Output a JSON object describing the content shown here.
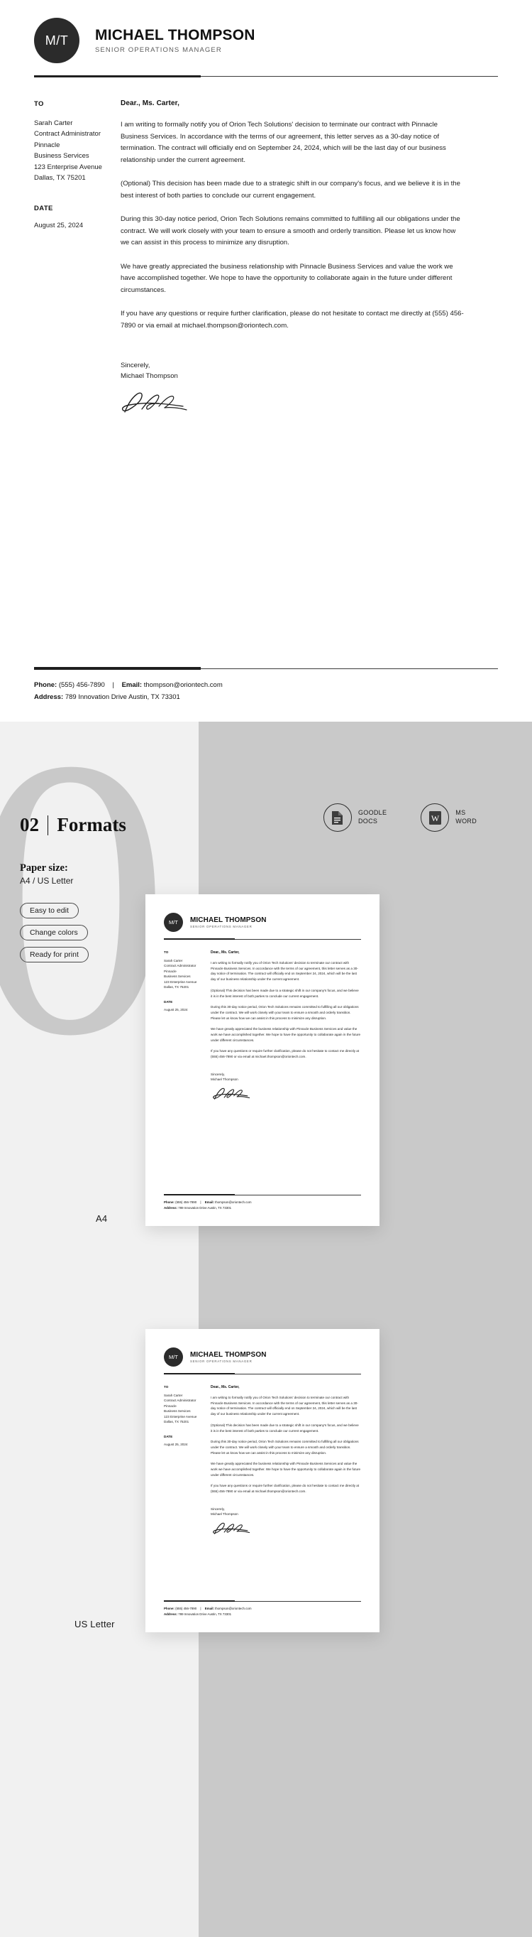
{
  "letterhead": {
    "monogram": "M/T",
    "name": "MICHAEL THOMPSON",
    "role": "SENIOR OPERATIONS MANAGER"
  },
  "meta": {
    "to_label": "TO",
    "recipient": [
      "Sarah Carter",
      "Contract Administrator",
      "Pinnacle",
      "Business Services",
      "123 Enterprise Avenue",
      "Dallas, TX 75201"
    ],
    "date_label": "DATE",
    "date_value": "August 25, 2024"
  },
  "letter": {
    "salutation": "Dear., Ms. Carter,",
    "paragraphs": [
      "I am writing to formally notify you of Orion Tech Solutions' decision to terminate our contract with Pinnacle Business Services. In accordance with the terms of our agreement, this letter serves as a 30-day notice of termination. The contract will officially end on September 24, 2024, which will be the last day of our business relationship under the current agreement.",
      "(Optional) This decision has been made due to a strategic shift in our company's focus, and we believe it is in the best interest of both parties to conclude our current engagement.",
      "During this 30-day notice period, Orion Tech Solutions remains committed to fulfilling all our obligations under the contract. We will work closely with your team to ensure a smooth and orderly transition. Please let us know how we can assist in this process to minimize any disruption.",
      "We have greatly appreciated the business relationship with Pinnacle Business Services and value the work we have accomplished together. We hope to have the opportunity to collaborate again in the future under different circumstances.",
      "If you have any questions or require further clarification, please do not hesitate to contact me directly at (555) 456-7890 or via email at michael.thompson@oriontech.com."
    ],
    "closing": "Sincerely,",
    "signer": "Michael Thompson"
  },
  "footer": {
    "phone_label": "Phone:",
    "phone_value": "(555) 456-7890",
    "separator": "|",
    "email_label": "Email:",
    "email_value": "thompson@oriontech.com",
    "address_label": "Address:",
    "address_value": "789 Innovation Drive Austin, TX 73301"
  },
  "formats": {
    "section_number": "02",
    "section_title": "Formats",
    "paper_size_label": "Paper size:",
    "paper_size_value": "A4 / US Letter",
    "pills": [
      "Easy to edit",
      "Change colors",
      "Ready for print"
    ],
    "badges": [
      {
        "icon": "google-docs-icon",
        "line1": "GOODLE",
        "line2": "DOCS"
      },
      {
        "icon": "ms-word-icon",
        "line1": "MS",
        "line2": "WORD"
      }
    ],
    "preview_labels": {
      "a4": "A4",
      "us": "US Letter"
    },
    "mini_paragraphs": [
      "I am writing to formally notify you of Orion Tech Solutions' decision to terminate our contract with Pinnacle Business Services. In accordance with the terms of our agreement, this letter serves as a 30-day notice of termination. The contract will officially end on September 24, 2024, which will be the last day of our business relationship under the current agreement.",
      "(Optional) This decision has been made due to a strategic shift in our company's focus, and we believe it is in the best interest of both parties to conclude our current engagement.",
      "During this 30-day notice period, Orion Tech Solutions remains committed to fulfilling all our obligations under the contract. We will work closely with your team to ensure a smooth and orderly transition. Please let us know how we can assist in this process to minimize any disruption.",
      "We have greatly appreciated the business relationship with Pinnacle Business Services and value the work we have accomplished together. We hope to have the opportunity to collaborate again in the future under different circumstances.",
      "If you have any questions or require further clarification, please do not hesitate to contact me directly at (555) 456-7890 or via email at michael.thompson@oriontech.com."
    ]
  },
  "colors": {
    "ink": "#1f1f1f",
    "monogram_bg": "#2b2b2b",
    "panel_light": "#f1f1f1",
    "panel_gray": "#c9c9c9",
    "paper": "#ffffff"
  }
}
